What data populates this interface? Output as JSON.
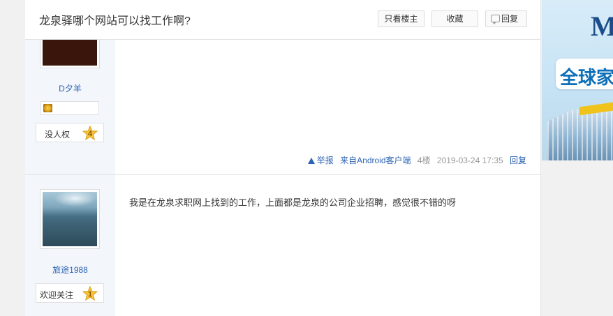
{
  "thread": {
    "title": "龙泉驿哪个网站可以找工作啊?",
    "buttons": {
      "only_op": "只看楼主",
      "favorite": "收藏",
      "reply": "回复"
    }
  },
  "posts": [
    {
      "username": "D夕羊",
      "level_title": "没人权",
      "level": "4",
      "footer": {
        "report": "举报",
        "source": "来自Android客户端",
        "floor": "4楼",
        "time": "2019-03-24 17:35",
        "reply": "回复"
      }
    },
    {
      "username": "旅途1988",
      "level_title": "欢迎关注",
      "level": "1",
      "content": "我是在龙泉求职网上找到的工作，上面都是龙泉的公司企业招聘，感觉很不错的呀"
    }
  ],
  "ad": {
    "letter": "M",
    "slogan": "全球家居"
  },
  "colors": {
    "link_blue": "#2d64b3",
    "sidebar_bg": "#f3f6fb",
    "star_gold": "#f5c33b"
  }
}
